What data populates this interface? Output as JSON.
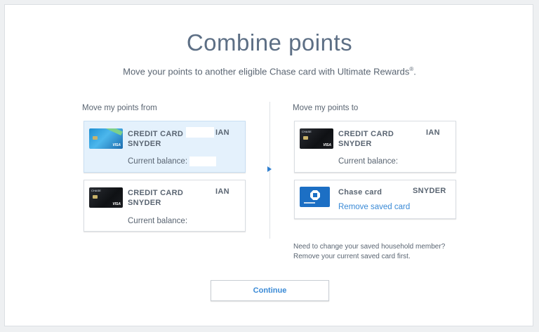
{
  "page": {
    "title": "Combine points",
    "subtitle": "Move your points to another eligible Chase card with Ultimate Rewards",
    "subtitle_mark": "®",
    "subtitle_end": "."
  },
  "from": {
    "label": "Move my points from",
    "cards": [
      {
        "name": "CREDIT CARD",
        "suffix": "IAN",
        "name2": "SNYDER",
        "balance_label": "Current balance:",
        "selected": true,
        "image": "chase-freedom-card"
      },
      {
        "name": "CREDIT CARD",
        "suffix": "IAN",
        "name2": "SNYDER",
        "balance_label": "Current balance:",
        "selected": false,
        "image": "chase-sapphire-card"
      }
    ]
  },
  "to": {
    "label": "Move my points to",
    "cards": [
      {
        "name": "CREDIT CARD",
        "suffix": "IAN",
        "name2": "SNYDER",
        "balance_label": "Current balance:",
        "image": "chase-sapphire-card"
      },
      {
        "name": "Chase card",
        "suffix": "SNYDER",
        "link": "Remove saved card",
        "image": "chase-logo"
      }
    ]
  },
  "note": {
    "line1": "Need to change your saved household member?",
    "line2": "Remove your current saved card first."
  },
  "continue_label": "Continue",
  "colors": {
    "accent": "#3a8ad6",
    "selected_bg": "#e4f1fc",
    "text": "#5a6572",
    "title": "#5d6f85"
  }
}
